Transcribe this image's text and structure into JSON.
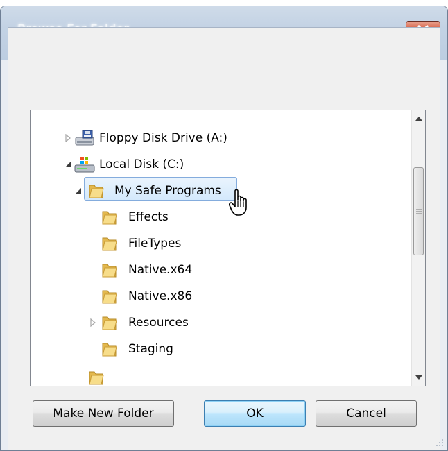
{
  "window": {
    "title": "Browse For Folder",
    "close_label": "Close"
  },
  "tree": {
    "items": [
      {
        "label": "Floppy Disk Drive (A:)",
        "icon": "floppy-drive-icon",
        "expander": "collapsed"
      },
      {
        "label": "Local Disk (C:)",
        "icon": "hard-disk-icon",
        "expander": "expanded"
      },
      {
        "label": "My Safe Programs",
        "icon": "folder-icon",
        "expander": "expanded",
        "selected": true
      },
      {
        "label": "Effects",
        "icon": "folder-icon",
        "expander": "none"
      },
      {
        "label": "FileTypes",
        "icon": "folder-icon",
        "expander": "none"
      },
      {
        "label": "Native.x64",
        "icon": "folder-icon",
        "expander": "none"
      },
      {
        "label": "Native.x86",
        "icon": "folder-icon",
        "expander": "none"
      },
      {
        "label": "Resources",
        "icon": "folder-icon",
        "expander": "collapsed"
      },
      {
        "label": "Staging",
        "icon": "folder-icon",
        "expander": "none"
      }
    ]
  },
  "buttons": {
    "make_new_folder": "Make New Folder",
    "ok": "OK",
    "cancel": "Cancel"
  },
  "colors": {
    "selection_bg": "#d4e9fc",
    "selection_border": "#84acdd",
    "close_button": "#c13a1d"
  }
}
